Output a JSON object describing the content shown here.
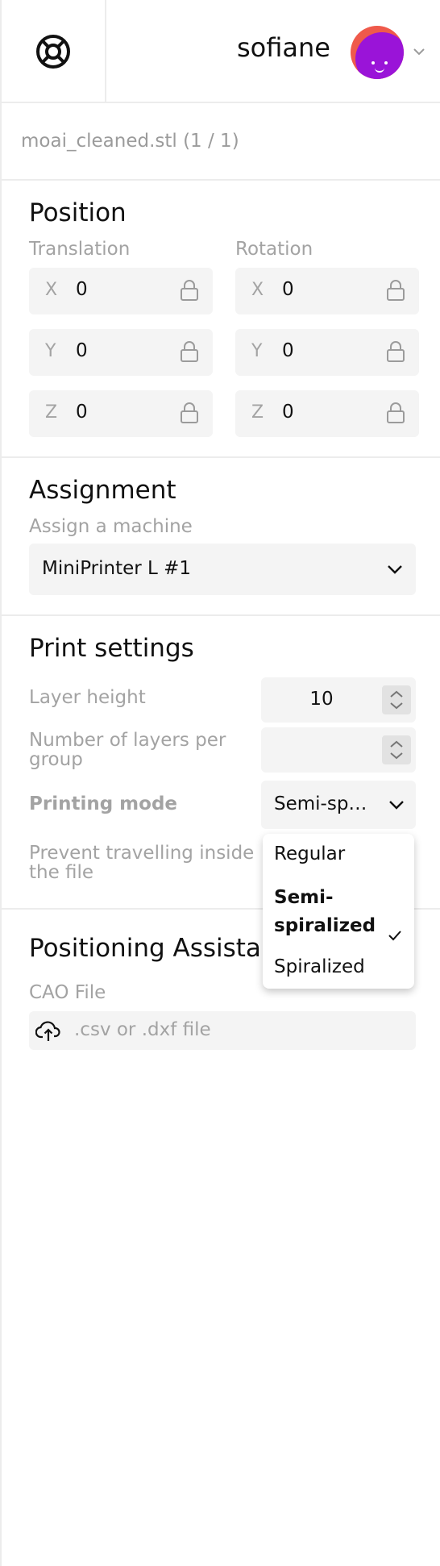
{
  "header": {
    "username": "sofiane",
    "help_icon": "lifebuoy-icon",
    "avatar_colors": {
      "outer": "#ef5a4b",
      "inner": "#9a14d8"
    }
  },
  "file": {
    "name": "moai_cleaned.stl (1 / 1)"
  },
  "position": {
    "title": "Position",
    "translation_label": "Translation",
    "rotation_label": "Rotation",
    "translation": [
      {
        "axis": "X",
        "value": "0"
      },
      {
        "axis": "Y",
        "value": "0"
      },
      {
        "axis": "Z",
        "value": "0"
      }
    ],
    "rotation": [
      {
        "axis": "X",
        "value": "0"
      },
      {
        "axis": "Y",
        "value": "0"
      },
      {
        "axis": "Z",
        "value": "0"
      }
    ]
  },
  "assignment": {
    "title": "Assignment",
    "label": "Assign a machine",
    "selected": "MiniPrinter L #1"
  },
  "print_settings": {
    "title": "Print settings",
    "layer_height_label": "Layer height",
    "layer_height_value": "10",
    "layers_per_group_label": "Number of layers per group",
    "layers_per_group_value": "",
    "printing_mode_label": "Printing mode",
    "printing_mode_value": "Semi-sp…",
    "prevent_travel_label": "Prevent travelling inside the file",
    "printing_mode_options": [
      "Regular",
      "Semi-spiralized",
      "Spiralized"
    ],
    "printing_mode_selected": "Semi-spiralized"
  },
  "positioning": {
    "title": "Positioning Assistance",
    "cao_label": "CAO File",
    "upload_placeholder": ".csv or .dxf file"
  },
  "colors": {
    "field_bg": "#f4f4f4",
    "muted_text": "#a3a3a3",
    "divider": "#ececec"
  }
}
